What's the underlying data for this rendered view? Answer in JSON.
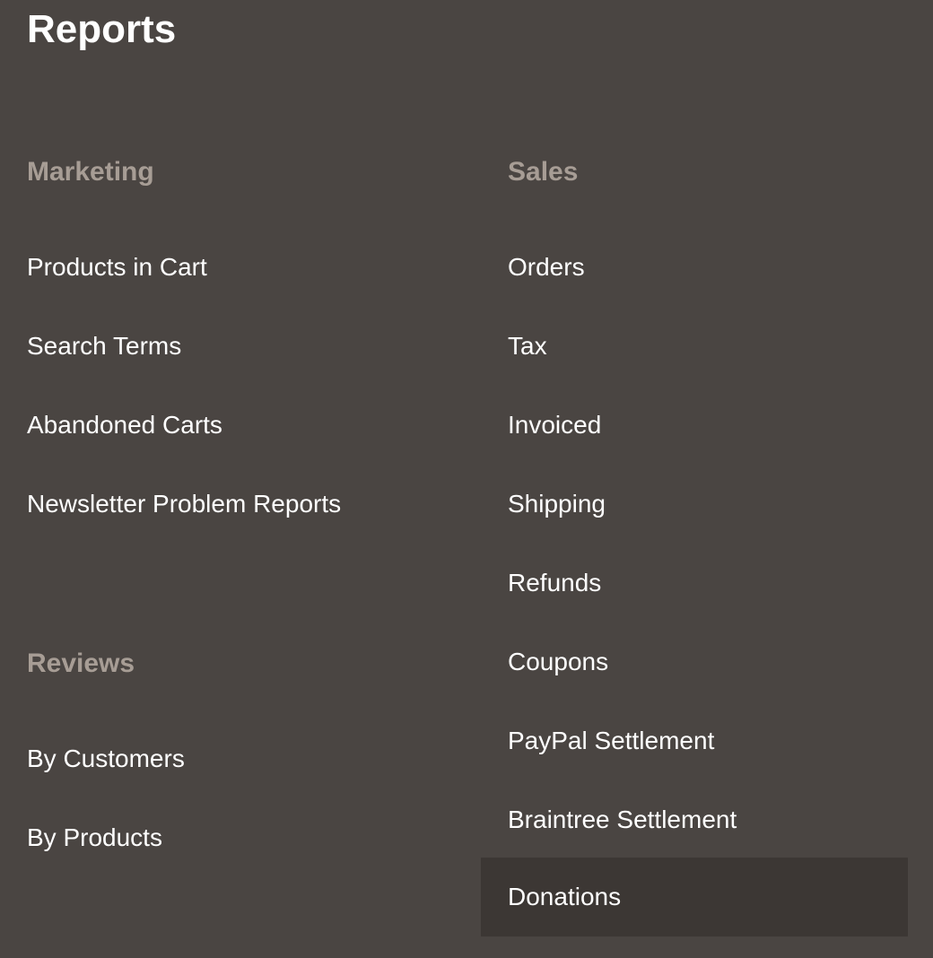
{
  "page": {
    "title": "Reports"
  },
  "sections": {
    "marketing": {
      "heading": "Marketing",
      "items": [
        {
          "label": "Products in Cart"
        },
        {
          "label": "Search Terms"
        },
        {
          "label": "Abandoned Carts"
        },
        {
          "label": "Newsletter Problem Reports"
        }
      ]
    },
    "reviews": {
      "heading": "Reviews",
      "items": [
        {
          "label": "By Customers"
        },
        {
          "label": "By Products"
        }
      ]
    },
    "sales": {
      "heading": "Sales",
      "items": [
        {
          "label": "Orders"
        },
        {
          "label": "Tax"
        },
        {
          "label": "Invoiced"
        },
        {
          "label": "Shipping"
        },
        {
          "label": "Refunds"
        },
        {
          "label": "Coupons"
        },
        {
          "label": "PayPal Settlement"
        },
        {
          "label": "Braintree Settlement"
        },
        {
          "label": "Donations",
          "active": true
        }
      ]
    }
  },
  "colors": {
    "background": "#4a4542",
    "heading": "#a79d95",
    "text": "#ffffff",
    "active_background": "#3c3734"
  }
}
